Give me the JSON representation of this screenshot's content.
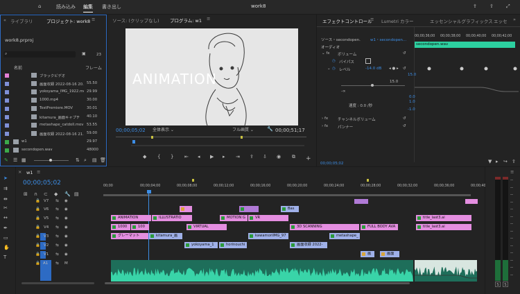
{
  "app": {
    "title": "work8",
    "nav": [
      "読み込み",
      "編集",
      "書き出し"
    ],
    "active_nav": "編集"
  },
  "project": {
    "tabs": [
      "ライブラリ",
      "プロジェクト: work8"
    ],
    "filename": "work8.prproj",
    "count": "23",
    "col_name": "名前",
    "col_rate": "フレーム",
    "items": [
      {
        "name": "ブラックビデオ",
        "rate": "",
        "color": "#e57fd6"
      },
      {
        "name": "画面収録 2022-08-16 20.5",
        "rate": "55.50",
        "color": "#7f90d6"
      },
      {
        "name": "yokoyama_IMG_1922.mo",
        "rate": "29.99",
        "color": "#7f90d6"
      },
      {
        "name": "1000.mp4",
        "rate": "30.00",
        "color": "#7f90d6"
      },
      {
        "name": "TestPremiere.MOV",
        "rate": "30.01",
        "color": "#7f90d6"
      },
      {
        "name": "kitamura_画面キャプチ",
        "rate": "40.10",
        "color": "#7f90d6"
      },
      {
        "name": "metashape_catdoll.mov",
        "rate": "53.55",
        "color": "#7f90d6"
      },
      {
        "name": "画面収録 2022-08-16 21.2",
        "rate": "59.00",
        "color": "#7f90d6"
      },
      {
        "name": "w1",
        "rate": "29.97",
        "color": "#3caa4a"
      },
      {
        "name": "secondopen.wav",
        "rate": "48000",
        "color": "#3caa4a"
      }
    ]
  },
  "source": {
    "tab_source": "ソース: (クリップなし)",
    "tab_program": "プログラム: w1",
    "overlay_text": "ANIMATION",
    "timecode": "00;00;05;02",
    "fit": "全体表示",
    "quality": "フル画質",
    "duration": "00;00;51;17"
  },
  "effects": {
    "tabs": [
      "エフェクトコントロール",
      "Lumetri カラー",
      "エッセンシャルグラフィックス",
      "エッセ"
    ],
    "source_label": "ソース・secondopen.",
    "seq_label": "w1・secondopen...",
    "audio": "オーディオ",
    "volume": "ボリューム",
    "bypass": "バイパス",
    "level": "レベル",
    "level_value": "-14.0 dB",
    "scale_hi": "15.0",
    "scale_lo": "-∞",
    "v1": "15.0",
    "v2": "0.0",
    "v3": "1.0",
    "v4": "-1.0",
    "speed": "速度 : 0.0 /秒",
    "channel_volume": "チャンネルボリューム",
    "panner": "パンナー",
    "timecode": "00;00;05;02",
    "times": [
      "00;00;36;00",
      "00;00;38;00",
      "00;00;40;00",
      "00;00;42;00"
    ],
    "clip_name": "secondopen.wav"
  },
  "timeline": {
    "tab": "w1",
    "timecode": "00;00;05;02",
    "ruler": [
      "00;00",
      "00;00;04;00",
      "00;00;08;00",
      "00;00;12;00",
      "00;00;16;00",
      "00;00;20;00",
      "00;00;24;00",
      "00;00;28;00",
      "00;00;32;00",
      "00;00;36;00",
      "00;00;40;00"
    ],
    "tracks": [
      "V7",
      "V6",
      "V5",
      "V4",
      "V3",
      "V2",
      "V1",
      "A1"
    ],
    "clips": {
      "v6_bas": "Bas",
      "v5_animation": "ANIMATION",
      "v5_illustration": "ILLUSTRATIO",
      "v5_motion": "MOTION G",
      "v5_vr": "VR",
      "v5_title": "title_last3.ai",
      "v4_1000": "1000",
      "v4_100": "100",
      "v4_virtual": "VIRTUAL",
      "v4_3d": "3D SCANNING",
      "v4_full": "FULL BODY AVA",
      "v4_title": "title_last3.ai",
      "v3_gray": "グレーマット",
      "v3_kitamura": "kitamura_画",
      "v3_kawamori": "kawamoriIMG_97",
      "v3_metashape": "metashape_",
      "v2_yokoyama": "yokoyama_1",
      "v2_horinouchi": "horinouchi",
      "v2_gamen": "画面収録 2022-",
      "v1_gamen1": "画",
      "v1_gamen2": "画面"
    },
    "meter_labels": [
      "S",
      "S"
    ]
  }
}
